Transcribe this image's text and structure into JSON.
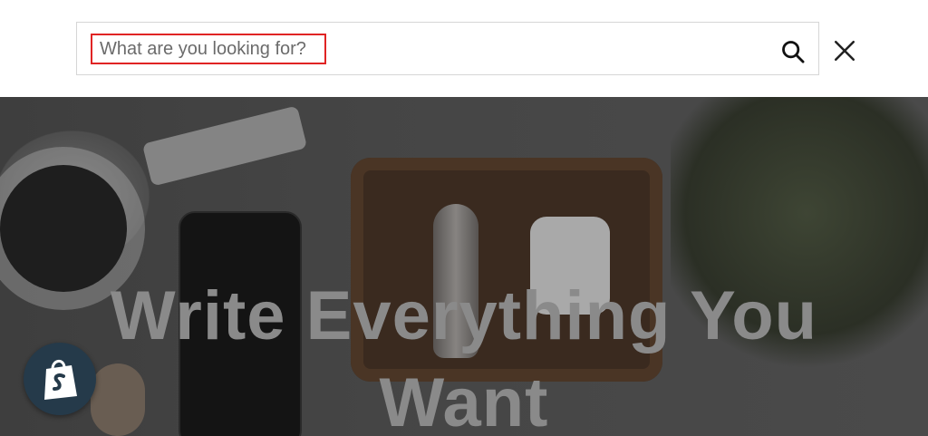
{
  "search": {
    "placeholder": "What are you looking for?",
    "value": ""
  },
  "icons": {
    "search": "search-icon",
    "close": "close-icon",
    "shopify": "shopify-bag-icon"
  },
  "hero": {
    "title_line1": "Write Everything You",
    "title_line2": "Want"
  },
  "colors": {
    "highlight_border": "#e02424",
    "badge_bg": "#253a4a"
  }
}
